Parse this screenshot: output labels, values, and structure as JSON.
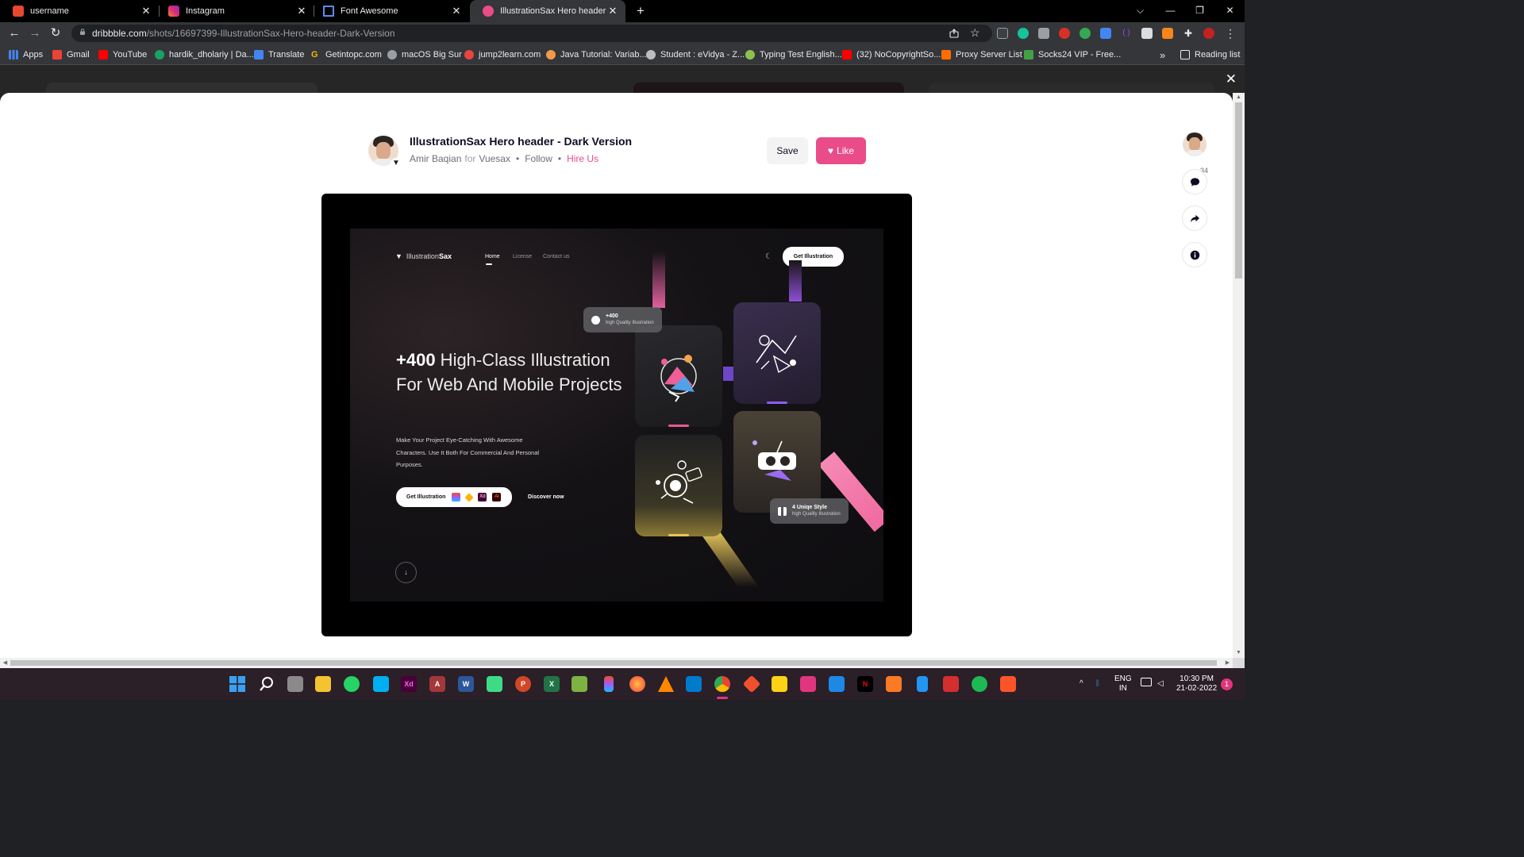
{
  "browser": {
    "tabs": [
      {
        "title": "username",
        "active": false,
        "favicon_color": "#e6492d",
        "favicon": "bar-square-icon"
      },
      {
        "title": "Instagram",
        "active": false,
        "favicon_color": "#dd2a7b",
        "favicon": "instagram-icon"
      },
      {
        "title": "Font Awesome",
        "active": false,
        "favicon_color": "#5b8def",
        "favicon": "flag-icon"
      },
      {
        "title": "IllustrationSax Hero header - Dar",
        "active": true,
        "favicon_color": "#ea4c89",
        "favicon": "dribbble-icon"
      }
    ],
    "tab_close_glyph": "✕",
    "new_tab_glyph": "+",
    "window_controls": {
      "dropdown": "⌵",
      "minimize": "—",
      "restore": "❐",
      "close": "✕"
    },
    "url_host": "dribbble.com",
    "url_path": "/shots/16697399-IllustrationSax-Hero-header-Dark-Version"
  },
  "bookmarks": {
    "apps": "Apps",
    "items": [
      {
        "label": "Gmail",
        "color": "#ea4335"
      },
      {
        "label": "YouTube",
        "color": "#ff0000"
      },
      {
        "label": "hardik_dholariy | Da...",
        "color": "#1aa260"
      },
      {
        "label": "Translate",
        "color": "#4285f4"
      },
      {
        "label": "Getintopc.com",
        "color": "#f4b400"
      },
      {
        "label": "macOS Big Sur",
        "color": "#9aa0a6"
      },
      {
        "label": "jump2learn.com",
        "color": "#e8453c"
      },
      {
        "label": "Java Tutorial: Variab...",
        "color": "#f2994a"
      },
      {
        "label": "Student : eVidya - Z...",
        "color": "#bdbdbd"
      },
      {
        "label": "Typing Test English...",
        "color": "#8bc34a"
      },
      {
        "label": "(32) NoCopyrightSo...",
        "color": "#ff0000"
      },
      {
        "label": "Proxy Server List",
        "color": "#ff6d00"
      },
      {
        "label": "Socks24 VIP - Free...",
        "color": "#43a047"
      }
    ],
    "overflow": "»",
    "reading_list": "Reading list"
  },
  "overlay": {
    "close_glyph": "✕"
  },
  "shot": {
    "title": "IllustrationSax Hero header - Dark Version",
    "author": "Amir Baqian",
    "for_text": "for",
    "team": "Vuesax",
    "follow": "Follow",
    "hire": "Hire Us",
    "save": "Save",
    "like": "Like",
    "comments_count": "34"
  },
  "rail": {
    "comment_icon": "💬",
    "share_icon": "➦",
    "info_icon": "i"
  },
  "preview": {
    "logo_prefix": "Illustration",
    "logo_bold": "Sax",
    "nav": [
      "Home",
      "License",
      "Contact us"
    ],
    "moon_glyph": "☾",
    "cta_top": "Get Illustration",
    "headline_bold": "+400",
    "headline_rest": " High-Class Illustration For Web And Mobile Projects",
    "subcopy": "Make Your Project Eye-Catching With Awesome Characters. Use It Both For Commercial And Personal Purposes.",
    "cta_main": "Get Illustration",
    "discover": "Discover now",
    "scroll_glyph": "↓",
    "badge1_title": "+400",
    "badge1_sub": "high Quality Illustration",
    "badge2_title": "4 Uniqe Style",
    "badge2_sub": "high Quality Illustration"
  },
  "taskbar": {
    "apps": [
      {
        "name": "start-icon",
        "label": "",
        "color": "#2b88d8"
      },
      {
        "name": "search-icon",
        "label": "",
        "color": "#2b1f28"
      },
      {
        "name": "task-view-icon",
        "label": "",
        "color": "#777"
      },
      {
        "name": "file-explorer-icon",
        "label": "",
        "color": "#f4c430"
      },
      {
        "name": "whatsapp-icon",
        "label": "",
        "color": "#25d366"
      },
      {
        "name": "skype-icon",
        "label": "",
        "color": "#00aff0"
      },
      {
        "name": "adobe-xd-icon",
        "label": "Xd",
        "color": "#470137"
      },
      {
        "name": "access-icon",
        "label": "A",
        "color": "#a4373a"
      },
      {
        "name": "word-icon",
        "label": "W",
        "color": "#2b579a"
      },
      {
        "name": "android-studio-icon",
        "label": "",
        "color": "#3ddc84"
      },
      {
        "name": "powerpoint-icon",
        "label": "P",
        "color": "#d24726"
      },
      {
        "name": "excel-icon",
        "label": "X",
        "color": "#217346"
      },
      {
        "name": "notepad-icon",
        "label": "",
        "color": "#7cb342"
      },
      {
        "name": "figma-icon",
        "label": "",
        "color": "#a259ff"
      },
      {
        "name": "firefox-icon",
        "label": "",
        "color": "#ff7139"
      },
      {
        "name": "vlc-icon",
        "label": "",
        "color": "#ff8800"
      },
      {
        "name": "vscode-icon",
        "label": "",
        "color": "#007acc"
      },
      {
        "name": "chrome-icon",
        "label": "",
        "color": "#4285f4"
      },
      {
        "name": "git-icon",
        "label": "",
        "color": "#f1502f"
      },
      {
        "name": "sticky-notes-icon",
        "label": "",
        "color": "#fcd116"
      },
      {
        "name": "cisco-packet-icon",
        "label": "",
        "color": "#e0367d"
      },
      {
        "name": "virtualbox-icon",
        "label": "",
        "color": "#1e88e5"
      },
      {
        "name": "netflix-icon",
        "label": "N",
        "color": "#000"
      },
      {
        "name": "xampp-icon",
        "label": "",
        "color": "#fb7a24"
      },
      {
        "name": "notepad-blue-icon",
        "label": "",
        "color": "#2196f3"
      },
      {
        "name": "acrobat-icon",
        "label": "",
        "color": "#d32f2f"
      },
      {
        "name": "spotify-icon",
        "label": "",
        "color": "#1db954"
      },
      {
        "name": "brave-icon",
        "label": "",
        "color": "#fb542b"
      }
    ],
    "caret": "^",
    "lang_top": "ENG",
    "lang_bottom": "IN",
    "time": "10:30 PM",
    "date": "21-02-2022",
    "notifications": "1"
  }
}
